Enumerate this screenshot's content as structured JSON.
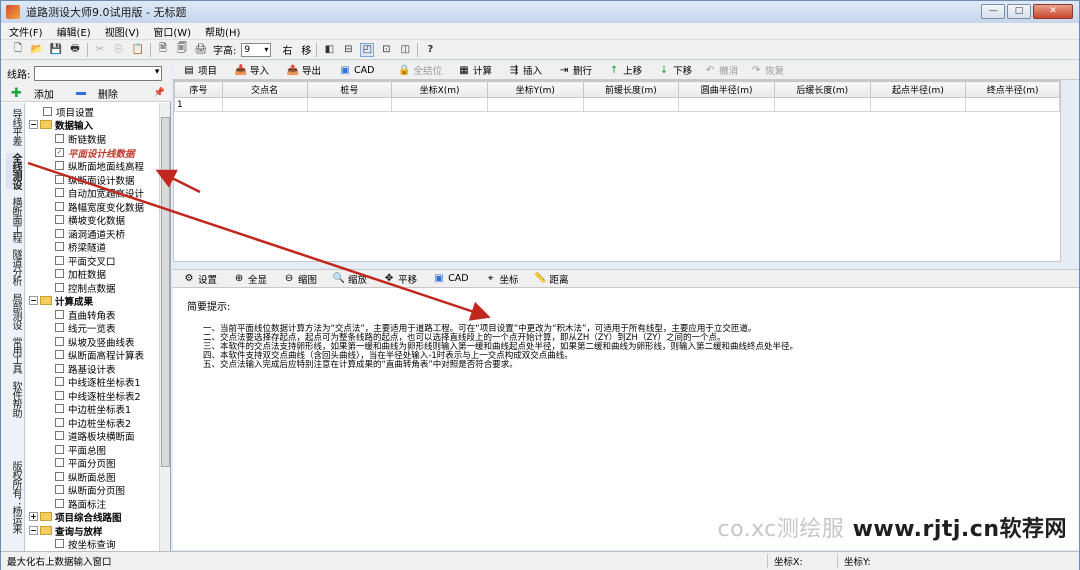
{
  "window": {
    "title": "道路测设大师9.0试用版 - 无标题",
    "buttons": [
      "—",
      "□",
      "✕"
    ]
  },
  "menu": [
    "文件(F)",
    "编辑(E)",
    "视图(V)",
    "窗口(W)",
    "帮助(H)"
  ],
  "toolbar": {
    "font_label": "字高:",
    "font_value": "9",
    "right_label": "右",
    "move_label": "移"
  },
  "left": {
    "line_label": "线路:",
    "add_label": "添加",
    "delete_label": "删除",
    "tabs": [
      "导线平差",
      "全线测设",
      "横断面工程",
      "隧道分析",
      "局部测设",
      "常用工具",
      "软件帮助",
      "版权所有：杨运来"
    ],
    "tree": {
      "project_settings": "项目设置",
      "data_input": "数据输入",
      "input_items": [
        "断链数据",
        "平面设计线数据",
        "纵断面地面线高程",
        "纵断面设计数据",
        "自动加宽超高设计",
        "路幅宽度变化数据",
        "横坡变化数据",
        "涵洞通道天桥",
        "桥梁隧道",
        "平面交叉口",
        "加桩数据",
        "控制点数据"
      ],
      "results": "计算成果",
      "result_items": [
        "直曲转角表",
        "线元一览表",
        "纵坡及竖曲线表",
        "纵断面高程计算表",
        "路基设计表",
        "中线逐桩坐标表1",
        "中线逐桩坐标表2",
        "中边桩坐标表1",
        "中边桩坐标表2",
        "道路板块横断面",
        "平面总图",
        "平面分页图",
        "纵断面总图",
        "纵断面分页图",
        "路面标注"
      ],
      "overview": "项目综合线路图",
      "query": "查询与放样",
      "query_items": [
        "按坐标查询"
      ]
    }
  },
  "main_toolbar": [
    "项目",
    "导入",
    "导出",
    "CAD",
    "全结位",
    "计算",
    "插入",
    "删行",
    "上移",
    "下移",
    "撤消",
    "恢复"
  ],
  "grid": {
    "headers": [
      "序号",
      "交点名",
      "桩号",
      "坐标X(m)",
      "坐标Y(m)",
      "前缓长度(m)",
      "圆曲半径(m)",
      "后缓长度(m)",
      "起点半径(m)",
      "终点半径(m)"
    ],
    "first_row": "1"
  },
  "lower_toolbar": [
    "设置",
    "全显",
    "缩图",
    "缩放",
    "平移",
    "CAD",
    "坐标",
    "距离"
  ],
  "notes": {
    "title": "简要提示:",
    "lines": [
      "一、当前平面线位数据计算方法为“交点法”，主要适用于道路工程。可在“项目设置”中更改为“积木法”，可适用于所有线型，主要应用于立交匝道。",
      "二、交点法要选择存起点，起点可为整条线路的起点，也可以选择直线段上的一个点开始计算，即从ZH（ZY）到ZH（ZY）之间的一个点。",
      "三、本软件的交点法支持卵形线，如果第一缓和曲线为卵形线则输入第一缓和曲线起点处半径，如果第二缓和曲线为卵形线，则输入第二缓和曲线终点处半径。",
      "四、本软件支持双交点曲线（含回头曲线），当在半径处输入-1时表示与上一交点构成双交点曲线。",
      "五、交点法输入完成后应特别注意在计算成果的“直曲转角表”中对照是否符合要求。"
    ]
  },
  "status": {
    "message": "最大化右上数据输入窗口",
    "x_label": "坐标X:",
    "y_label": "坐标Y:"
  },
  "watermark": {
    "faint": "co.xc测绘服",
    "brand": "www.rjtj.cn软荐网"
  },
  "colors": {
    "accent": "#2f6fd8",
    "arrow": "#c0281f",
    "highlight": "#c0392b"
  }
}
